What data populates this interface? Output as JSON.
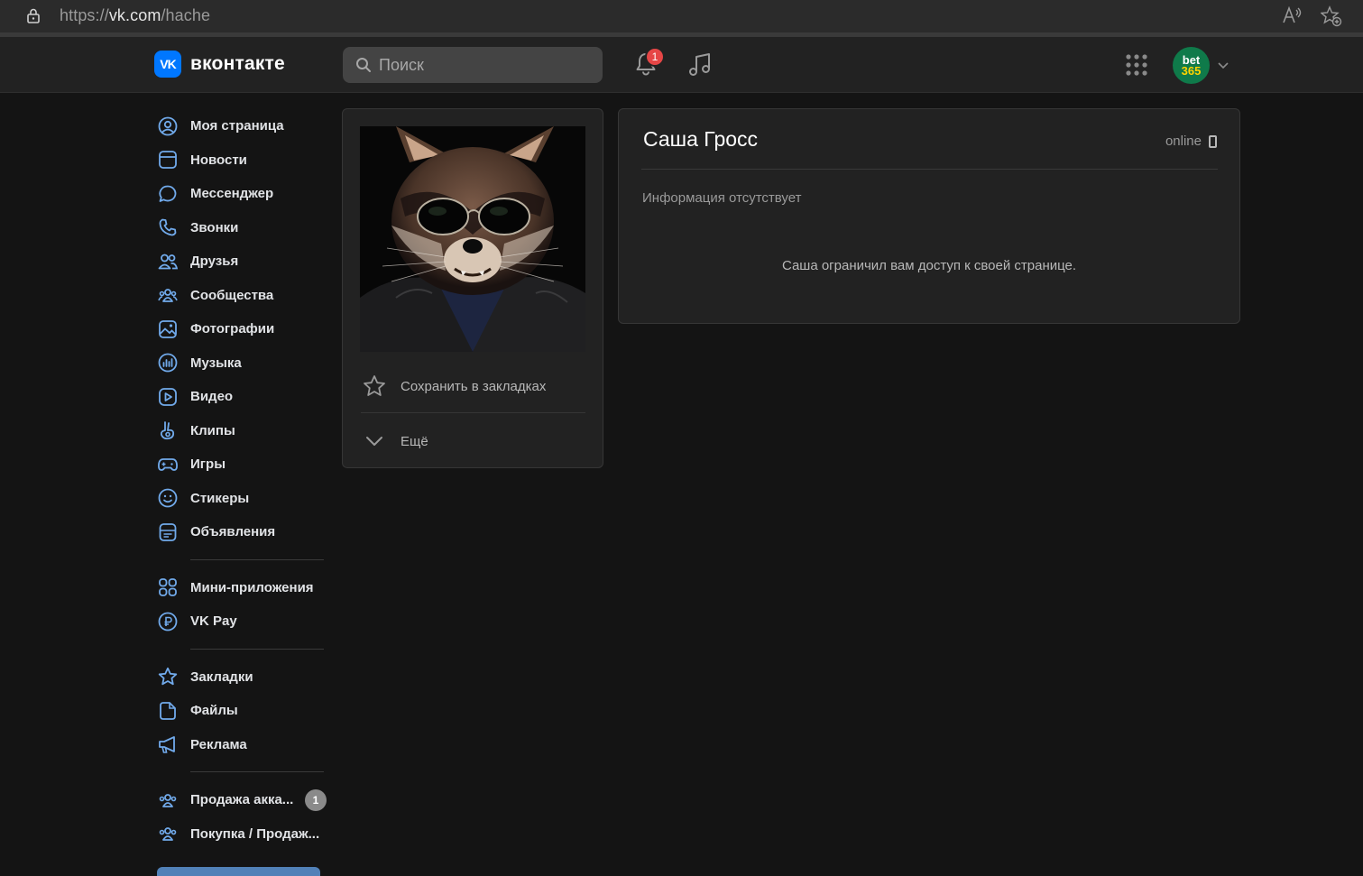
{
  "browser": {
    "url_prefix": "https://",
    "url_host": "vk.com",
    "url_path": "/hache"
  },
  "header": {
    "logo_mark": "VK",
    "logo_text": "вконтакте",
    "search_placeholder": "Поиск",
    "notifications_count": "1",
    "avatar_line1": "bet",
    "avatar_line2": "365"
  },
  "sidebar": {
    "items": [
      {
        "label": "Моя страница",
        "icon": "user-circle-icon"
      },
      {
        "label": "Новости",
        "icon": "newsfeed-icon"
      },
      {
        "label": "Мессенджер",
        "icon": "message-icon"
      },
      {
        "label": "Звонки",
        "icon": "phone-icon"
      },
      {
        "label": "Друзья",
        "icon": "friends-icon"
      },
      {
        "label": "Сообщества",
        "icon": "communities-icon"
      },
      {
        "label": "Фотографии",
        "icon": "photo-icon"
      },
      {
        "label": "Музыка",
        "icon": "music-icon"
      },
      {
        "label": "Видео",
        "icon": "video-icon"
      },
      {
        "label": "Клипы",
        "icon": "clips-icon"
      },
      {
        "label": "Игры",
        "icon": "gamepad-icon"
      },
      {
        "label": "Стикеры",
        "icon": "smile-icon"
      },
      {
        "label": "Объявления",
        "icon": "classifieds-icon"
      }
    ],
    "apps": [
      {
        "label": "Мини-приложения",
        "icon": "mini-apps-icon"
      },
      {
        "label": "VK Pay",
        "icon": "vkpay-icon"
      }
    ],
    "tools": [
      {
        "label": "Закладки",
        "icon": "star-icon"
      },
      {
        "label": "Файлы",
        "icon": "file-icon"
      },
      {
        "label": "Реклама",
        "icon": "megaphone-icon"
      }
    ],
    "groups": [
      {
        "label": "Продажа акка...",
        "badge": "1",
        "icon": "group-icon"
      },
      {
        "label": "Покупка / Продаж...",
        "icon": "group-icon"
      }
    ]
  },
  "photo_card": {
    "bookmark_label": "Сохранить в закладках",
    "more_label": "Ещё"
  },
  "profile": {
    "name": "Саша Гросс",
    "status": "online",
    "no_info": "Информация отсутствует",
    "restricted_message": "Саша ограничил вам доступ к своей странице."
  }
}
